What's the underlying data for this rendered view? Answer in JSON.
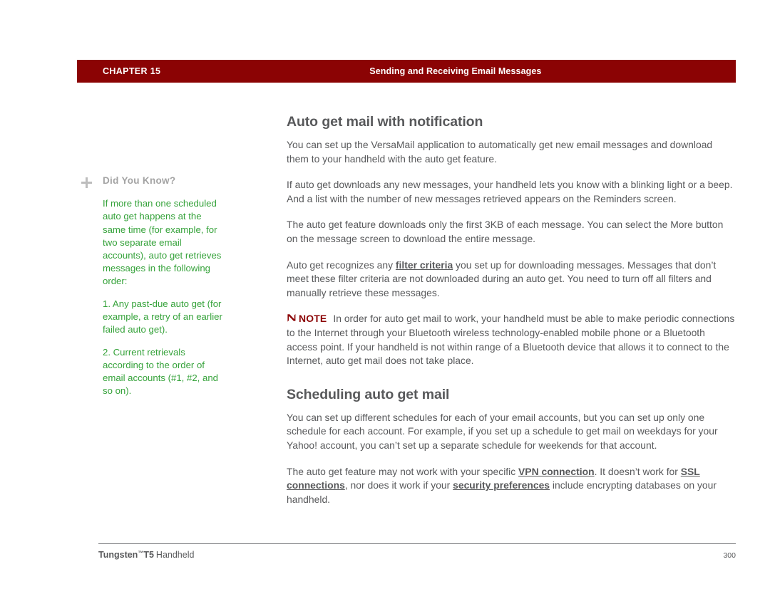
{
  "header": {
    "chapter_label": "CHAPTER 15",
    "running_title": "Sending and Receiving Email Messages",
    "bar_color": "#8b0304"
  },
  "sidebar": {
    "plus_icon": "plus-icon",
    "title": "Did You Know?",
    "text_color": "#35a23a",
    "paragraphs": [
      "If more than one scheduled auto get happens at the same time (for example, for two separate email accounts), auto get retrieves messages in the following order:",
      "1. Any past-due auto get (for example, a retry of an earlier failed auto get).",
      "2. Current retrievals according to the order of email accounts (#1, #2, and so on)."
    ]
  },
  "main": {
    "heading_1": "Auto get mail with notification",
    "paragraph_1": "You can set up the VersaMail application to automatically get new email messages and download them to your handheld with the auto get feature.",
    "paragraph_2": "If auto get downloads any new messages, your handheld lets you know with a blinking light or a beep. And a list with the number of new messages retrieved appears on the Reminders screen.",
    "paragraph_3": "The auto get feature downloads only the first 3KB of each message. You can select the More button on the message screen to download the entire message.",
    "paragraph_4": {
      "before_link": "Auto get recognizes any ",
      "link": "filter criteria",
      "after_link": " you set up for downloading messages. Messages that don’t meet these filter criteria are not downloaded during an auto get. You need to turn off all filters and manually retrieve these messages."
    },
    "note": {
      "icon": "note-flag-icon",
      "label": "NOTE",
      "label_color": "#8b0304",
      "text": "In order for auto get mail to work, your handheld must be able to make periodic connections to the Internet through your Bluetooth wireless technology-enabled mobile phone or a Bluetooth access point. If your handheld is not within range of a Bluetooth device that allows it to connect to the Internet, auto get mail does not take place."
    },
    "heading_2": "Scheduling auto get mail",
    "paragraph_5": "You can set up different schedules for each of your email accounts, but you can set up only one schedule for each account. For example, if you set up a schedule to get mail on weekdays for your Yahoo! account, you can’t set up a separate schedule for weekends for that account.",
    "paragraph_6": {
      "seg_1": "The auto get feature may not work with your specific ",
      "link_1": "VPN connection",
      "seg_2": ". It doesn’t work for ",
      "link_2": "SSL connections",
      "seg_3": ", nor does it work if your ",
      "link_3": "security preferences",
      "seg_4": " include encrypting databases on your handheld."
    }
  },
  "footer": {
    "product": "Tungsten",
    "trademark": "™",
    "model": "T5",
    "kind": "Handheld",
    "page_number": "300"
  }
}
